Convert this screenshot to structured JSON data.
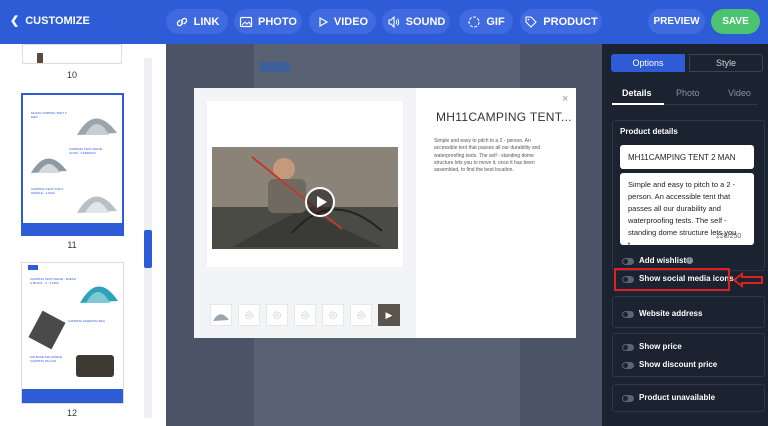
{
  "header": {
    "back_label": "CUSTOMIZE",
    "tools": [
      "LINK",
      "PHOTO",
      "VIDEO",
      "SOUND",
      "GIF",
      "PRODUCT"
    ],
    "preview_label": "PREVIEW",
    "save_label": "SAVE"
  },
  "sidebar": {
    "pages": [
      "10",
      "11",
      "12"
    ],
    "thumb_texts": [
      "MH100 CAMPING TENT 2 MAN",
      "CAMPING TENT MH100 - ULTIM - 3 PERSON",
      "CAMPING TENT FOR 4 PEOPLE - 4 MAN",
      "CAMPING TENT MH100 - FRESH & BLACK - 3 - 4 MAN",
      "CAMPING SLEEPING BAG",
      "AIR BASE INFLATABLE CAMPING PILLOW"
    ]
  },
  "modal": {
    "title": "MH11CAMPING TENT...",
    "description": "Simple and easy to pitch to a 2 - person. An accessible tent that passes all our durability and waterproofing tests. The self - standing dome structure lets you to move it, once it has been assembled, to find the best location.",
    "close": "×"
  },
  "panel": {
    "tabs": [
      "Options",
      "Style"
    ],
    "subtabs": [
      "Details",
      "Photo",
      "Video"
    ],
    "product_details_label": "Product details",
    "product_name": "MH11CAMPING TENT 2 MAN",
    "product_desc": "Simple and easy to pitch to a 2 - person. An accessible tent that passes all our durability and waterproofing tests. The self - standing dome structure lets you t...",
    "char_count": "228/250",
    "options": {
      "add_wishlist": "Add wishlist",
      "show_social": "Show social media icons",
      "website_address": "Website address",
      "show_price": "Show price",
      "show_discount": "Show discount price",
      "product_unavailable": "Product unavailable"
    }
  },
  "colors": {
    "brand": "#2e5bd6",
    "save": "#4cc46f",
    "highlight": "#e02020"
  }
}
